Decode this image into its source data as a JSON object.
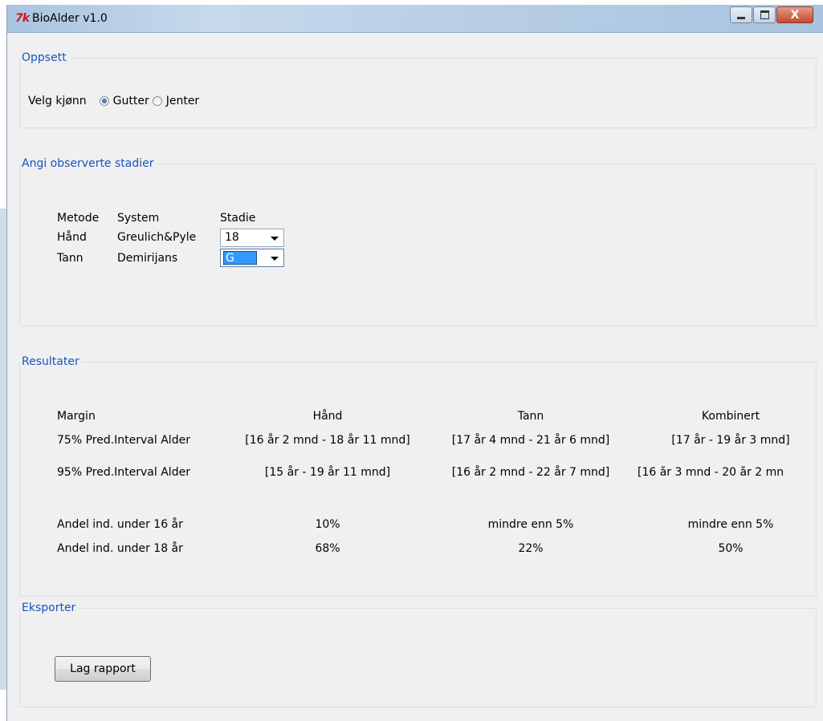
{
  "window": {
    "app_icon": "7k",
    "title": "BioAlder v1.0",
    "close_label": "X"
  },
  "setup": {
    "legend": "Oppsett",
    "gender_label": "Velg kjønn",
    "options": [
      {
        "label": "Gutter",
        "checked": true
      },
      {
        "label": "Jenter",
        "checked": false
      }
    ]
  },
  "stages": {
    "legend": "Angi observerte stadier",
    "headers": {
      "method": "Metode",
      "system": "System",
      "stage": "Stadie"
    },
    "rows": [
      {
        "method": "Hånd",
        "system": "Greulich&Pyle",
        "stage": "18"
      },
      {
        "method": "Tann",
        "system": "Demirijans",
        "stage": "G"
      }
    ]
  },
  "results": {
    "legend": "Resultater",
    "headers": {
      "margin": "Margin",
      "hand": "Hånd",
      "tooth": "Tann",
      "combined": "Kombinert"
    },
    "rows": [
      {
        "label": "75% Pred.Interval Alder",
        "hand": "[16 år 2 mnd - 18 år 11 mnd]",
        "tooth": "[17 år 4 mnd - 21 år 6 mnd]",
        "combined": "[17 år - 19 år 3 mnd]"
      },
      {
        "label": "95% Pred.Interval Alder",
        "hand": "[15 år - 19 år 11 mnd]",
        "tooth": "[16 år 2 mnd - 22 år 7 mnd]",
        "combined": "[16 år 3 mnd - 20 år 2 mn"
      },
      {
        "label": "Andel ind. under 16 år",
        "hand": "10%",
        "tooth": "mindre enn 5%",
        "combined": "mindre enn 5%"
      },
      {
        "label": "Andel ind. under 18 år",
        "hand": "68%",
        "tooth": "22%",
        "combined": "50%"
      }
    ]
  },
  "export": {
    "legend": "Eksporter",
    "button_label": "Lag rapport"
  }
}
